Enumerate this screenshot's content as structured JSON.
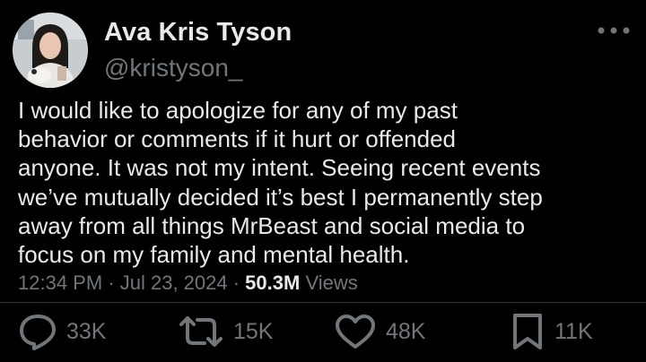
{
  "author": {
    "display_name": "Ava Kris Tyson",
    "handle": "@kristyson_",
    "avatar_icon": "profile-photo"
  },
  "more_icon": "ellipsis-icon",
  "tweet": {
    "text": "I would like to apologize for any of my past\nbehavior or comments if it hurt or offended\nanyone. It was not my intent. Seeing recent events\nwe’ve mutually decided it’s best I permanently step\naway from all things MrBeast and social media to\nfocus on my family and mental health."
  },
  "meta": {
    "time": "12:34 PM",
    "separator": " · ",
    "date": "Jul 23, 2024",
    "views_count": "50.3M",
    "views_label": " Views"
  },
  "actions": {
    "replies": "33K",
    "retweets": "15K",
    "likes": "48K",
    "bookmarks": "11K"
  },
  "colors": {
    "background": "#000000",
    "text_primary": "#e7e9ea",
    "text_secondary": "#71767b"
  }
}
